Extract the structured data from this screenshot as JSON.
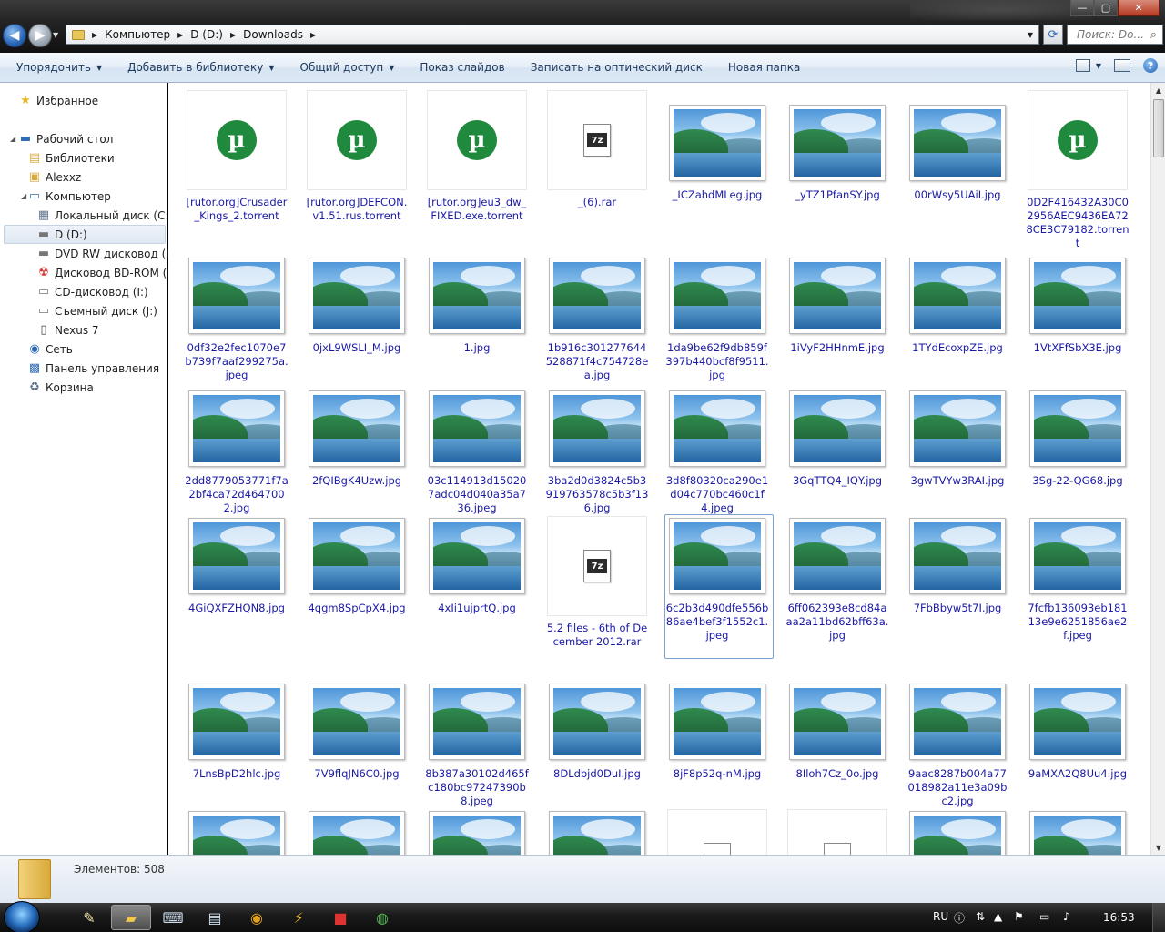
{
  "window": {
    "buttons": {
      "minimize": "—",
      "maximize": "▢",
      "close": "✕"
    }
  },
  "address": {
    "crumbs": [
      "Компьютер",
      "D (D:)",
      "Downloads"
    ],
    "search_placeholder": "Поиск: Do..."
  },
  "toolbar": {
    "organize": "Упорядочить",
    "add_to_library": "Добавить в библиотеку",
    "share": "Общий доступ",
    "slideshow": "Показ слайдов",
    "burn": "Записать на оптический диск",
    "new_folder": "Новая папка",
    "help": "?"
  },
  "navpane": {
    "favorites": "Избранное",
    "desktop": "Рабочий стол",
    "libraries": "Библиотеки",
    "user": "Alexxz",
    "computer": "Компьютер",
    "local_c": "Локальный диск (C:)",
    "d_drive": "D (D:)",
    "dvd": "DVD RW дисковод (E:)",
    "bd": "Дисковод BD-ROM (F:)",
    "cd": "CD-дисковод (I:)",
    "removable": "Съемный диск (J:)",
    "nexus": "Nexus 7",
    "network": "Сеть",
    "control_panel": "Панель управления",
    "recycle": "Корзина"
  },
  "files": [
    [
      {
        "name": "[rutor.org]Crusader_Kings_2.torrent",
        "type": "torrent"
      },
      {
        "name": "[rutor.org]DEFCON.v1.51.rus.torrent",
        "type": "torrent"
      },
      {
        "name": "[rutor.org]eu3_dw_FIXED.exe.torrent",
        "type": "torrent"
      },
      {
        "name": "_(6).rar",
        "type": "archive"
      },
      {
        "name": "_ICZahdMLeg.jpg",
        "type": "image"
      },
      {
        "name": "_yTZ1PfanSY.jpg",
        "type": "image"
      },
      {
        "name": "00rWsy5UAiI.jpg",
        "type": "image"
      },
      {
        "name": "0D2F416432A30C02956AEC9436EA728CE3C79182.torrent",
        "type": "torrent"
      }
    ],
    [
      {
        "name": "0df32e2fec1070e7b739f7aaf299275a.jpeg",
        "type": "image"
      },
      {
        "name": "0jxL9WSLI_M.jpg",
        "type": "image"
      },
      {
        "name": "1.jpg",
        "type": "image"
      },
      {
        "name": "1b916c301277644528871f4c754728ea.jpg",
        "type": "image"
      },
      {
        "name": "1da9be62f9db859f397b440bcf8f9511.jpg",
        "type": "image"
      },
      {
        "name": "1iVyF2HHnmE.jpg",
        "type": "image"
      },
      {
        "name": "1TYdEcoxpZE.jpg",
        "type": "image"
      },
      {
        "name": "1VtXFfSbX3E.jpg",
        "type": "image"
      }
    ],
    [
      {
        "name": "2dd8779053771f7a2bf4ca72d4647002.jpg",
        "type": "image"
      },
      {
        "name": "2fQIBgK4Uzw.jpg",
        "type": "image"
      },
      {
        "name": "03c114913d150207adc04d040a35a736.jpeg",
        "type": "image"
      },
      {
        "name": "3ba2d0d3824c5b3919763578c5b3f136.jpg",
        "type": "image"
      },
      {
        "name": "3d8f80320ca290e1d04c770bc460c1f4.jpeg",
        "type": "image"
      },
      {
        "name": "3GqTTQ4_IQY.jpg",
        "type": "image"
      },
      {
        "name": "3gwTVYw3RAI.jpg",
        "type": "image"
      },
      {
        "name": "3Sg-22-QG68.jpg",
        "type": "image"
      }
    ],
    [
      {
        "name": "4GiQXFZHQN8.jpg",
        "type": "image"
      },
      {
        "name": "4qgm8SpCpX4.jpg",
        "type": "image"
      },
      {
        "name": "4xIi1ujprtQ.jpg",
        "type": "image"
      },
      {
        "name": "5.2 files - 6th of December 2012.rar",
        "type": "archive"
      },
      {
        "name": "6c2b3d490dfe556b86ae4bef3f1552c1.jpeg",
        "type": "image",
        "selected": true
      },
      {
        "name": "6ff062393e8cd84aaa2a11bd62bff63a.jpg",
        "type": "image"
      },
      {
        "name": "7FbBbyw5t7I.jpg",
        "type": "image"
      },
      {
        "name": "7fcfb136093eb18113e9e6251856ae2f.jpeg",
        "type": "image"
      }
    ],
    [
      {
        "name": "7LnsBpD2hlc.jpg",
        "type": "image"
      },
      {
        "name": "7V9flqJN6C0.jpg",
        "type": "image"
      },
      {
        "name": "8b387a30102d465fc180bc97247390b8.jpeg",
        "type": "image"
      },
      {
        "name": "8DLdbjd0DuI.jpg",
        "type": "image"
      },
      {
        "name": "8jF8p52q-nM.jpg",
        "type": "image"
      },
      {
        "name": "8Iloh7Cz_0o.jpg",
        "type": "image"
      },
      {
        "name": "9aac8287b004a77018982a11e3a09bc2.jpg",
        "type": "image"
      },
      {
        "name": "9aMXA2Q8Uu4.jpg",
        "type": "image"
      }
    ],
    [
      {
        "name": "",
        "type": "image"
      },
      {
        "name": "",
        "type": "image"
      },
      {
        "name": "",
        "type": "image"
      },
      {
        "name": "",
        "type": "image"
      },
      {
        "name": "",
        "type": "doc"
      },
      {
        "name": "",
        "type": "doc"
      },
      {
        "name": "",
        "type": "image"
      },
      {
        "name": "",
        "type": "image"
      }
    ]
  ],
  "archive_badge": "7z",
  "torrent_glyph": "µ",
  "status": {
    "count": "Элементов: 508"
  },
  "taskbar": {
    "lang": "RU",
    "clock": "16:53"
  }
}
